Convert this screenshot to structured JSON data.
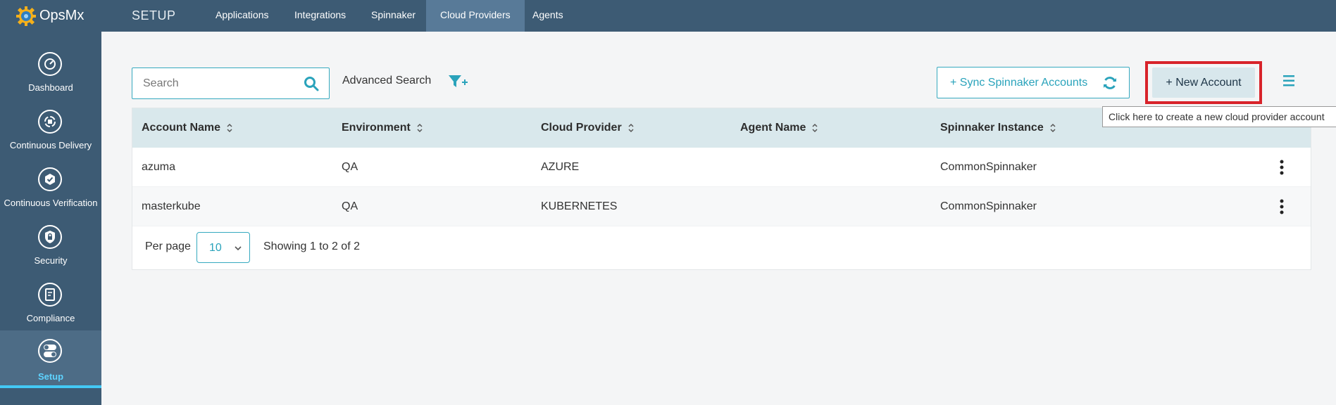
{
  "app": {
    "name": "OpsMx",
    "section": "SETUP"
  },
  "topnav": {
    "tabs": [
      {
        "label": "Applications"
      },
      {
        "label": "Integrations"
      },
      {
        "label": "Spinnaker"
      },
      {
        "label": "Cloud Providers",
        "active": true
      },
      {
        "label": "Agents"
      }
    ]
  },
  "sidebar": {
    "items": [
      {
        "label": "Dashboard",
        "icon": "dashboard-icon"
      },
      {
        "label": "Continuous Delivery",
        "icon": "continuous-delivery-icon"
      },
      {
        "label": "Continuous Verification",
        "icon": "continuous-verification-icon"
      },
      {
        "label": "Security",
        "icon": "lock-shield-icon"
      },
      {
        "label": "Compliance",
        "icon": "compliance-icon"
      },
      {
        "label": "Setup",
        "icon": "toggle-icon",
        "active": true
      }
    ]
  },
  "toolbar": {
    "search_placeholder": "Search",
    "advanced_search": "Advanced Search",
    "sync_label": "+ Sync Spinnaker Accounts",
    "new_account_label": "+ New Account",
    "tooltip": "Click here to create a new cloud provider account"
  },
  "table": {
    "columns": [
      "Account Name",
      "Environment",
      "Cloud Provider",
      "Agent Name",
      "Spinnaker Instance"
    ],
    "rows": [
      {
        "account": "azuma",
        "environment": "QA",
        "provider": "AZURE",
        "agent": "",
        "instance": "CommonSpinnaker"
      },
      {
        "account": "masterkube",
        "environment": "QA",
        "provider": "KUBERNETES",
        "agent": "",
        "instance": "CommonSpinnaker"
      }
    ]
  },
  "pagination": {
    "per_page_label": "Per page",
    "per_page_value": "10",
    "showing": "Showing 1 to 2 of 2"
  },
  "colors": {
    "nav_bg": "#3d5b74",
    "accent": "#36a9bf",
    "highlight": "#d8232a",
    "header_bg": "#d9e8ec"
  }
}
